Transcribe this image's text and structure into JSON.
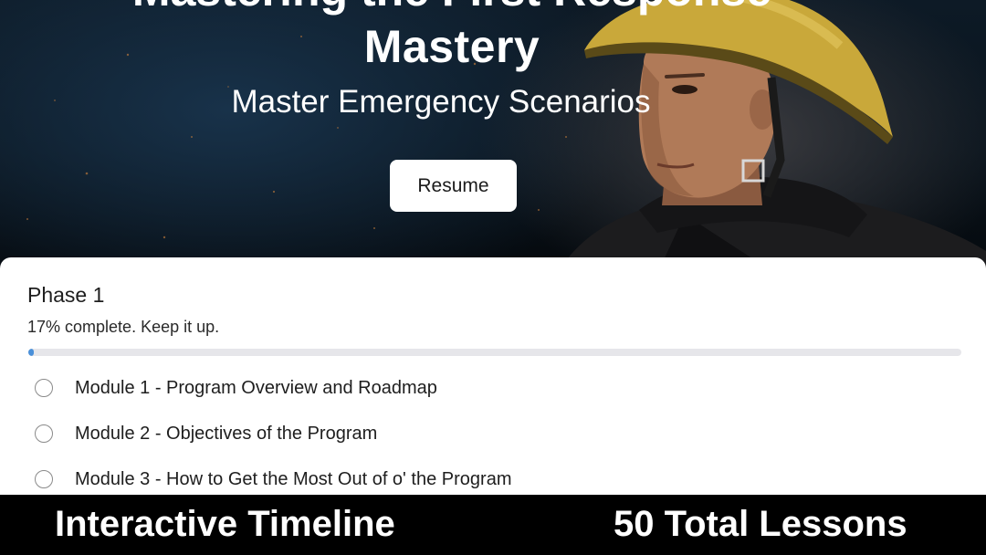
{
  "hero": {
    "title_top": "Mastering the First Response",
    "title": "Mastery",
    "subtitle": "Master Emergency Scenarios",
    "resume_label": "Resume"
  },
  "course": {
    "phase_title": "Phase 1",
    "progress_text": "17% complete. Keep it up.",
    "progress_fraction": 0.006,
    "modules": [
      {
        "label": "Module 1 - Program Overview and Roadmap"
      },
      {
        "label": "Module 2 - Objectives of the Program"
      },
      {
        "label": "Module 3 - How to Get the Most Out of o' the Program"
      }
    ]
  },
  "banner": {
    "left": "Interactive Timeline",
    "right": "50 Total Lessons"
  },
  "colors": {
    "accent": "#4a90d9",
    "helmet": "#c9a83a",
    "banner_bg": "#000000"
  }
}
